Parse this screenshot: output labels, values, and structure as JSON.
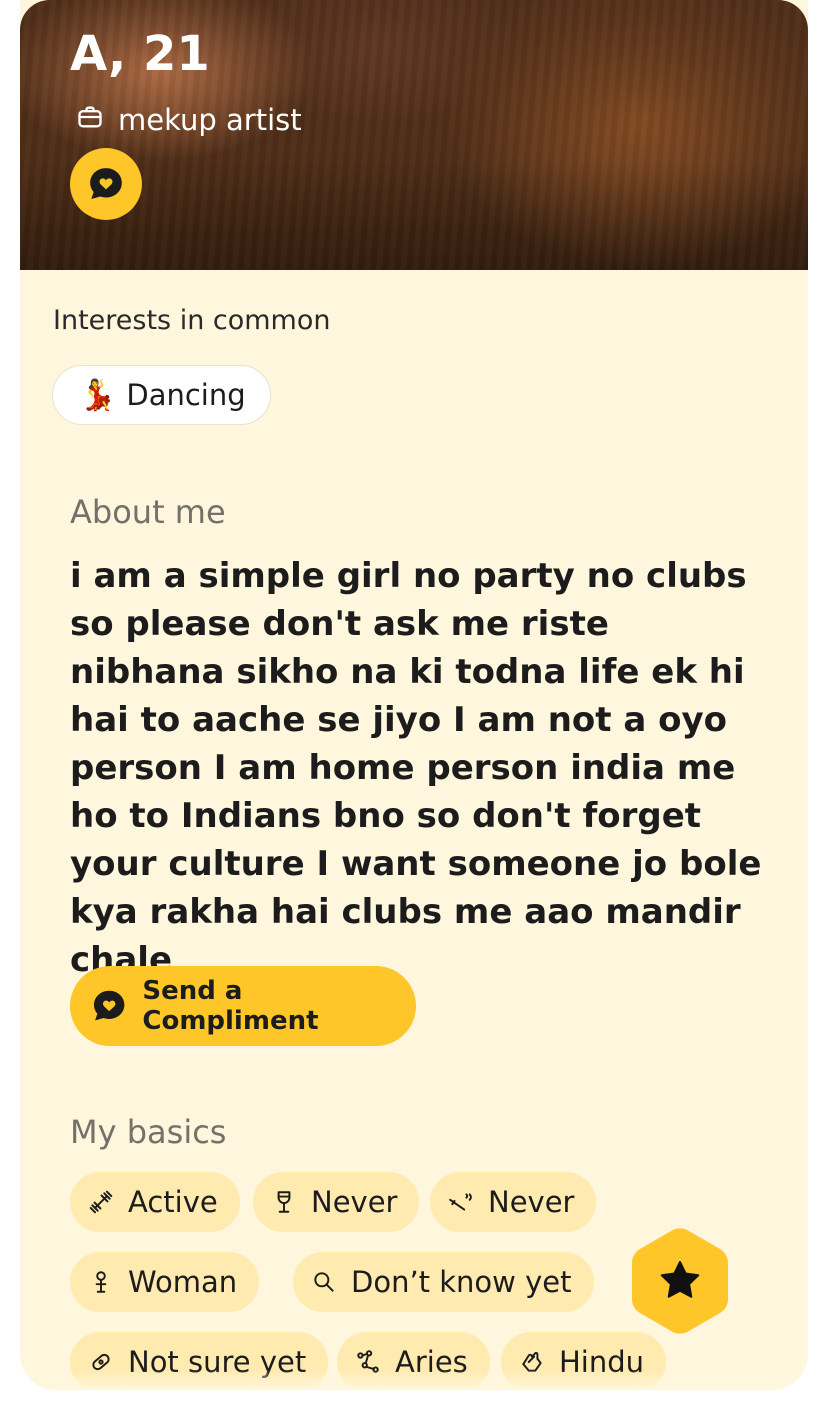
{
  "profile": {
    "name_age": "A, 21",
    "job": "mekup artist",
    "job_icon": "briefcase-icon"
  },
  "interests": {
    "label": "Interests in common",
    "items": [
      {
        "emoji": "💃",
        "label": "Dancing"
      }
    ]
  },
  "about": {
    "label": "About me",
    "text": "i am a simple girl no party no clubs so please don't ask me riste nibhana sikho na ki todna life ek hi hai to aache se jiyo I am not a oyo person I am home person india me ho to Indians bno so don't forget your culture I want someone jo bole kya rakha hai clubs me aao mandir chale"
  },
  "compliment_button": {
    "label": "Send a Compliment"
  },
  "basics": {
    "label": "My basics",
    "items": [
      {
        "icon": "dumbbell-icon",
        "label": "Active"
      },
      {
        "icon": "wine-glass-icon",
        "label": "Never"
      },
      {
        "icon": "smoking-icon",
        "label": "Never"
      },
      {
        "icon": "gender-icon",
        "label": "Woman"
      },
      {
        "icon": "magnifier-icon",
        "label": "Don’t know yet"
      },
      {
        "icon": "pacifier-icon",
        "label": "Not sure yet"
      },
      {
        "icon": "constellation-icon",
        "label": "Aries"
      },
      {
        "icon": "praying-hands-icon",
        "label": "Hindu"
      }
    ]
  },
  "colors": {
    "accent": "#ffc629",
    "card_background": "#fff6de",
    "chip_background": "#ffeab0",
    "muted_text": "#74706a"
  }
}
